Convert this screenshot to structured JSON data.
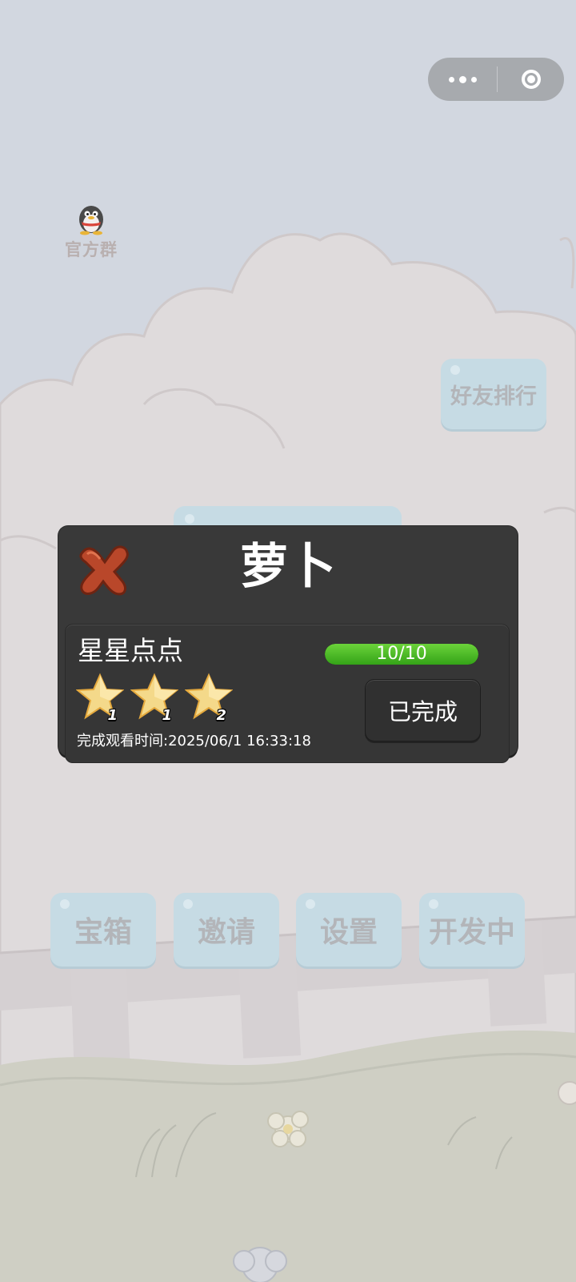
{
  "capsule": {
    "more_icon": "more-dots-icon",
    "close_icon": "target-circle-icon"
  },
  "official_group": {
    "label": "官方群",
    "icon": "qq-penguin-icon"
  },
  "friend_rank_label": "好友排行",
  "bottom_buttons": [
    {
      "label": "宝箱"
    },
    {
      "label": "邀请"
    },
    {
      "label": "设置"
    },
    {
      "label": "开发中"
    }
  ],
  "dialog": {
    "title": "萝卜",
    "close_icon": "red-x-icon",
    "achievement": {
      "name": "星星点点",
      "progress_text": "10/10",
      "progress_fraction": 1.0,
      "status_label": "已完成",
      "stars": [
        {
          "count": "1"
        },
        {
          "count": "1"
        },
        {
          "count": "2"
        }
      ],
      "completion_time": "完成观看时间:2025/06/1 16:33:18"
    }
  },
  "colors": {
    "panel": "#393939",
    "progress": "#4cc026",
    "pill": "#c6dbe4"
  }
}
